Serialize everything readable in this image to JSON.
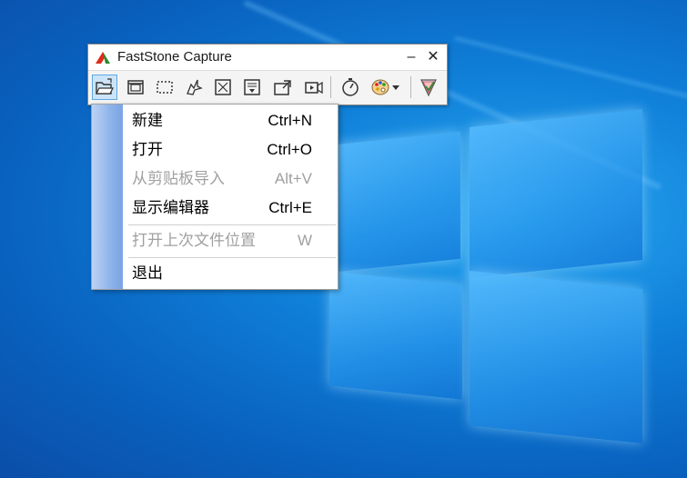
{
  "window": {
    "title": "FastStone Capture",
    "minimize_label": "–",
    "close_label": "✕"
  },
  "toolbar": {
    "tools": [
      {
        "icon": "open-folder-icon",
        "active": true
      },
      {
        "icon": "capture-window-icon"
      },
      {
        "icon": "capture-rectangle-icon"
      },
      {
        "icon": "capture-freehand-icon"
      },
      {
        "icon": "capture-fullscreen-icon"
      },
      {
        "icon": "capture-scrolling-icon"
      },
      {
        "icon": "output-icon"
      },
      {
        "icon": "screen-recorder-icon"
      },
      {
        "icon": "timer-icon"
      },
      {
        "icon": "color-palette-icon"
      },
      {
        "icon": "settings-icon"
      }
    ]
  },
  "menu": {
    "items": [
      {
        "label": "新建",
        "shortcut": "Ctrl+N",
        "enabled": true
      },
      {
        "label": "打开",
        "shortcut": "Ctrl+O",
        "enabled": true
      },
      {
        "label": "从剪贴板导入",
        "shortcut": "Alt+V",
        "enabled": false
      },
      {
        "label": "显示编辑器",
        "shortcut": "Ctrl+E",
        "enabled": true
      },
      {
        "label": "打开上次文件位置",
        "shortcut": "W",
        "enabled": false
      },
      {
        "label": "退出",
        "shortcut": "",
        "enabled": true
      }
    ]
  },
  "colors": {
    "desktop": "#0f7fd8",
    "menu_strip": "#8eb3ea",
    "active_tool": "#cce4f7"
  }
}
